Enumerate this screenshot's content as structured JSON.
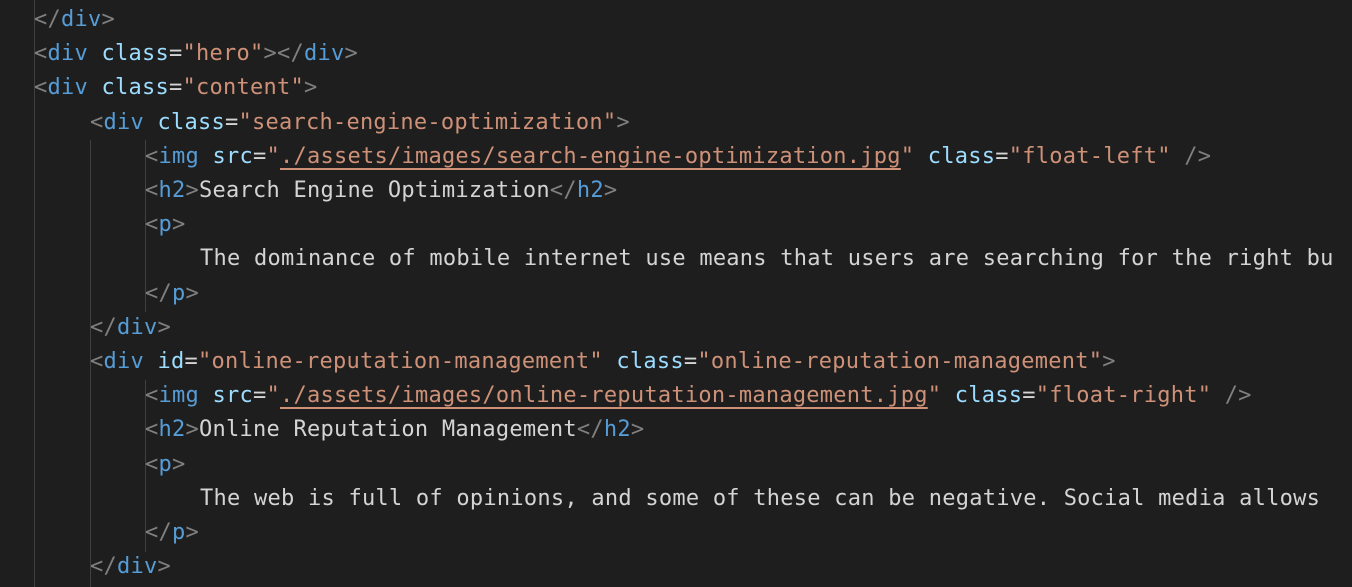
{
  "editor": {
    "language": "html",
    "colors": {
      "background": "#1e1e1e",
      "punctuation": "#808080",
      "tag": "#569cd6",
      "attribute": "#9cdcfe",
      "string": "#ce9178",
      "text": "#d4d4d4",
      "indent_guide": "#404040"
    },
    "lines": [
      {
        "indent": 0,
        "tokens": [
          [
            "p",
            "</"
          ],
          [
            "t",
            "div"
          ],
          [
            "p",
            ">"
          ]
        ]
      },
      {
        "indent": 0,
        "tokens": [
          [
            "p",
            "<"
          ],
          [
            "t",
            "div"
          ],
          [
            "x",
            " "
          ],
          [
            "a",
            "class"
          ],
          [
            "x",
            "="
          ],
          [
            "v",
            "\"hero\""
          ],
          [
            "p",
            "></"
          ],
          [
            "t",
            "div"
          ],
          [
            "p",
            ">"
          ]
        ]
      },
      {
        "indent": 0,
        "tokens": [
          [
            "p",
            "<"
          ],
          [
            "t",
            "div"
          ],
          [
            "x",
            " "
          ],
          [
            "a",
            "class"
          ],
          [
            "x",
            "="
          ],
          [
            "v",
            "\"content\""
          ],
          [
            "p",
            ">"
          ]
        ]
      },
      {
        "indent": 1,
        "tokens": [
          [
            "p",
            "<"
          ],
          [
            "t",
            "div"
          ],
          [
            "x",
            " "
          ],
          [
            "a",
            "class"
          ],
          [
            "x",
            "="
          ],
          [
            "v",
            "\"search-engine-optimization\""
          ],
          [
            "p",
            ">"
          ]
        ]
      },
      {
        "indent": 2,
        "tokens": [
          [
            "p",
            "<"
          ],
          [
            "t",
            "img"
          ],
          [
            "x",
            " "
          ],
          [
            "a",
            "src"
          ],
          [
            "x",
            "="
          ],
          [
            "v",
            "\""
          ],
          [
            "vu",
            "./assets/images/search-engine-optimization.jpg"
          ],
          [
            "v",
            "\""
          ],
          [
            "x",
            " "
          ],
          [
            "a",
            "class"
          ],
          [
            "x",
            "="
          ],
          [
            "v",
            "\"float-left\""
          ],
          [
            "x",
            " "
          ],
          [
            "p",
            "/>"
          ]
        ]
      },
      {
        "indent": 2,
        "tokens": [
          [
            "p",
            "<"
          ],
          [
            "t",
            "h2"
          ],
          [
            "p",
            ">"
          ],
          [
            "x",
            "Search Engine Optimization"
          ],
          [
            "p",
            "</"
          ],
          [
            "t",
            "h2"
          ],
          [
            "p",
            ">"
          ]
        ]
      },
      {
        "indent": 2,
        "tokens": [
          [
            "p",
            "<"
          ],
          [
            "t",
            "p"
          ],
          [
            "p",
            ">"
          ]
        ]
      },
      {
        "indent": 3,
        "tokens": [
          [
            "x",
            "The dominance of mobile internet use means that users are searching for the right bu"
          ]
        ]
      },
      {
        "indent": 2,
        "tokens": [
          [
            "p",
            "</"
          ],
          [
            "t",
            "p"
          ],
          [
            "p",
            ">"
          ]
        ]
      },
      {
        "indent": 1,
        "tokens": [
          [
            "p",
            "</"
          ],
          [
            "t",
            "div"
          ],
          [
            "p",
            ">"
          ]
        ]
      },
      {
        "indent": 1,
        "tokens": [
          [
            "p",
            "<"
          ],
          [
            "t",
            "div"
          ],
          [
            "x",
            " "
          ],
          [
            "a",
            "id"
          ],
          [
            "x",
            "="
          ],
          [
            "v",
            "\"online-reputation-management\""
          ],
          [
            "x",
            " "
          ],
          [
            "a",
            "class"
          ],
          [
            "x",
            "="
          ],
          [
            "v",
            "\"online-reputation-management\""
          ],
          [
            "p",
            ">"
          ]
        ]
      },
      {
        "indent": 2,
        "tokens": [
          [
            "p",
            "<"
          ],
          [
            "t",
            "img"
          ],
          [
            "x",
            " "
          ],
          [
            "a",
            "src"
          ],
          [
            "x",
            "="
          ],
          [
            "v",
            "\""
          ],
          [
            "vu",
            "./assets/images/online-reputation-management.jpg"
          ],
          [
            "v",
            "\""
          ],
          [
            "x",
            " "
          ],
          [
            "a",
            "class"
          ],
          [
            "x",
            "="
          ],
          [
            "v",
            "\"float-right\""
          ],
          [
            "x",
            " "
          ],
          [
            "p",
            "/>"
          ]
        ]
      },
      {
        "indent": 2,
        "tokens": [
          [
            "p",
            "<"
          ],
          [
            "t",
            "h2"
          ],
          [
            "p",
            ">"
          ],
          [
            "x",
            "Online Reputation Management"
          ],
          [
            "p",
            "</"
          ],
          [
            "t",
            "h2"
          ],
          [
            "p",
            ">"
          ]
        ]
      },
      {
        "indent": 2,
        "tokens": [
          [
            "p",
            "<"
          ],
          [
            "t",
            "p"
          ],
          [
            "p",
            ">"
          ]
        ]
      },
      {
        "indent": 3,
        "tokens": [
          [
            "x",
            "The web is full of opinions, and some of these can be negative. Social media allows"
          ]
        ]
      },
      {
        "indent": 2,
        "tokens": [
          [
            "p",
            "</"
          ],
          [
            "t",
            "p"
          ],
          [
            "p",
            ">"
          ]
        ]
      },
      {
        "indent": 1,
        "tokens": [
          [
            "p",
            "</"
          ],
          [
            "t",
            "div"
          ],
          [
            "p",
            ">"
          ]
        ]
      }
    ]
  }
}
